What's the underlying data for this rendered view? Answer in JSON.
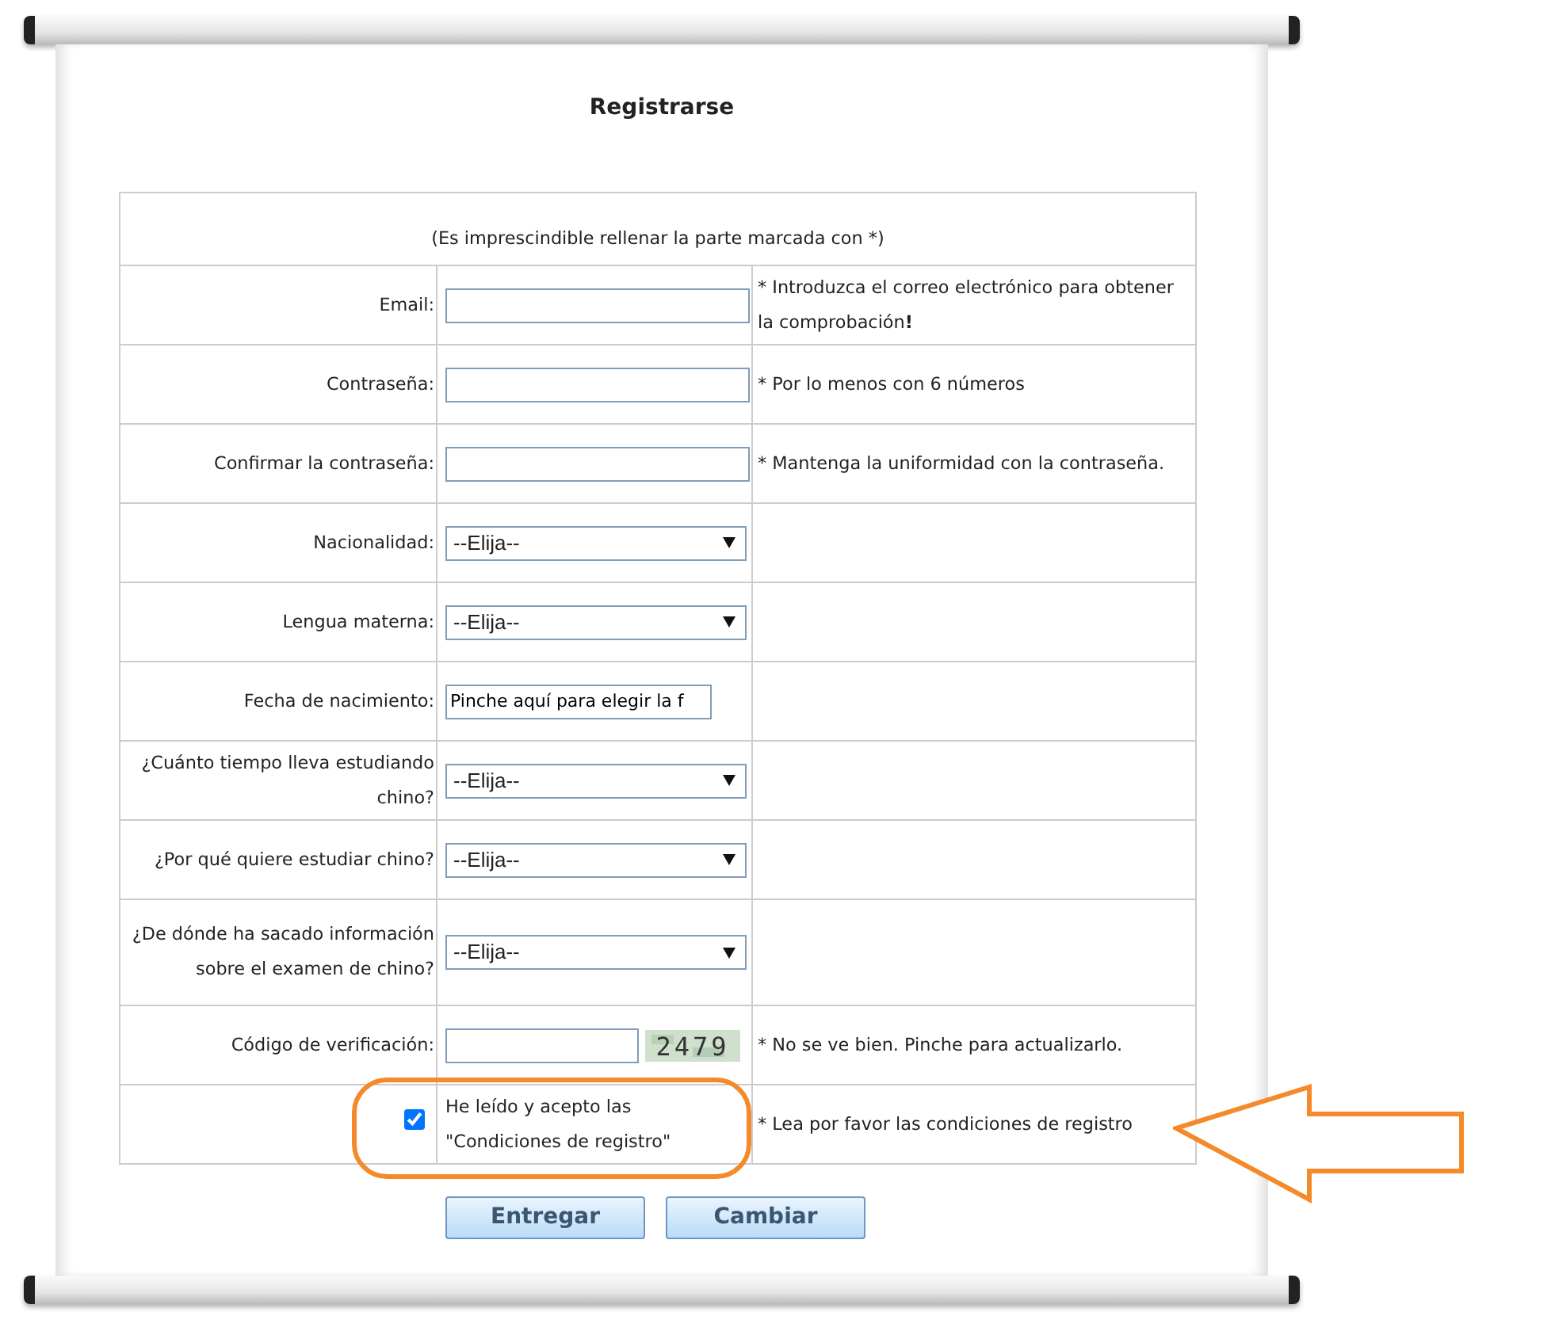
{
  "title": "Registrarse",
  "note": "(Es imprescindible rellenar la parte marcada con *)",
  "rows": [
    {
      "kind": "input",
      "label": "Email:",
      "hint": "* Introduzca el correo electrónico para obtener la comprobación**!**"
    },
    {
      "kind": "input",
      "label": "Contraseña:",
      "hint": "* Por lo menos con 6 números"
    },
    {
      "kind": "input",
      "label": "Confirmar la contraseña:",
      "hint": "* Mantenga la uniformidad con la contraseña."
    },
    {
      "kind": "select",
      "label": "Nacionalidad:",
      "value": "--Elija--"
    },
    {
      "kind": "select",
      "label": "Lengua materna:",
      "value": "--Elija--"
    },
    {
      "kind": "date",
      "label": "Fecha de nacimiento:",
      "value": "Pinche aquí para elegir la f"
    },
    {
      "kind": "select",
      "label": "¿Cuánto tiempo lleva estudiando chino?",
      "value": "--Elija--"
    },
    {
      "kind": "select",
      "label": "¿Por qué quiere estudiar chino?",
      "value": "--Elija--"
    },
    {
      "kind": "select",
      "label": "¿De dónde ha sacado información sobre el examen de chino?",
      "value": "--Elija--"
    },
    {
      "kind": "captcha",
      "label": "Código de verificación:",
      "captcha": "2479",
      "hint": "* No se ve bien. Pinche para actualizarlo."
    },
    {
      "kind": "checkbox",
      "checked": true,
      "text": "He leído y acepto las \"Condiciones de registro\"",
      "hint": "* Lea por favor las condiciones de registro"
    }
  ],
  "buttons": [
    "Entregar",
    "Cambiar"
  ]
}
